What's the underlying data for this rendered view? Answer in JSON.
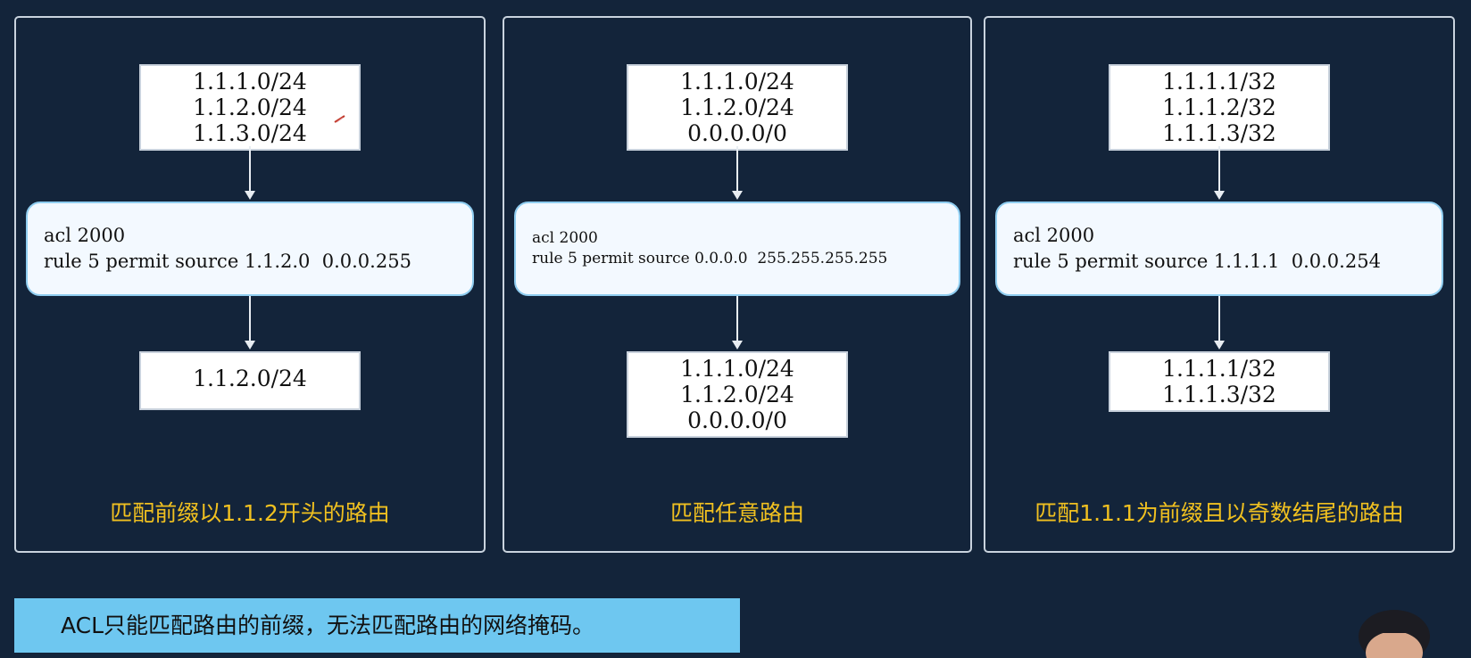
{
  "panels": [
    {
      "input": [
        "1.1.1.0/24",
        "1.1.2.0/24",
        "1.1.3.0/24"
      ],
      "rule": [
        "acl 2000",
        "rule 5 permit source 1.1.2.0  0.0.0.255"
      ],
      "output": [
        "1.1.2.0/24"
      ],
      "caption": "匹配前缀以1.1.2开头的路由"
    },
    {
      "input": [
        "1.1.1.0/24",
        "1.1.2.0/24",
        "0.0.0.0/0"
      ],
      "rule": [
        "acl 2000",
        "rule 5 permit source 0.0.0.0  255.255.255.255"
      ],
      "output": [
        "1.1.1.0/24",
        "1.1.2.0/24",
        "0.0.0.0/0"
      ],
      "caption": "匹配任意路由"
    },
    {
      "input": [
        "1.1.1.1/32",
        "1.1.1.2/32",
        "1.1.1.3/32"
      ],
      "rule": [
        "acl 2000",
        "rule 5 permit source 1.1.1.1  0.0.0.254"
      ],
      "output": [
        "1.1.1.1/32",
        "1.1.1.3/32"
      ],
      "caption": "匹配1.1.1为前缀且以奇数结尾的路由"
    }
  ],
  "note": "ACL只能匹配路由的前缀，无法匹配路由的网络掩码。",
  "colors": {
    "background": "#13243a",
    "caption": "#f0c020",
    "note_bg": "#6ec7f0",
    "rule_border": "#8fcdf0"
  }
}
